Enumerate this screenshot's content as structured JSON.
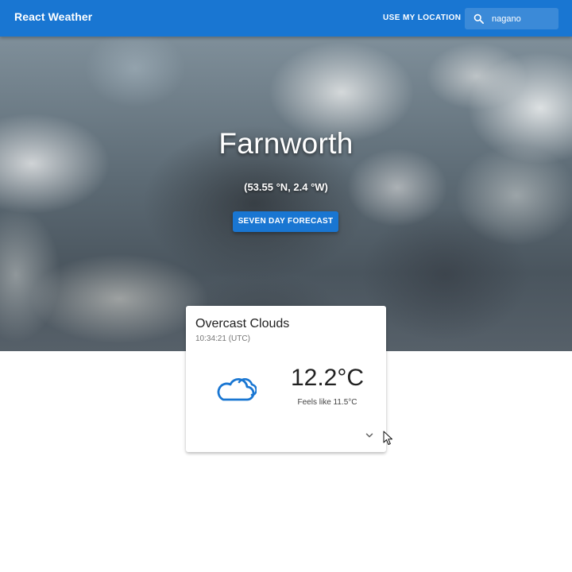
{
  "app": {
    "title": "React Weather"
  },
  "header": {
    "location_button": "Use my location",
    "search": {
      "value": "nagano",
      "icon": "search-icon"
    }
  },
  "hero": {
    "city": "Farnworth",
    "coordinates": "(53.55 °N, 2.4 °W)",
    "forecast_button": "Seven day forecast"
  },
  "current_weather": {
    "condition": "Overcast Clouds",
    "time": "10:34:21 (UTC)",
    "icon": "cloud-icon",
    "temperature": "12.2°C",
    "feels_like": "Feels like 11.5°C",
    "expand_icon": "chevron-down-icon"
  },
  "colors": {
    "primary": "#1976d2",
    "text": "#212121",
    "secondary_text": "#757575"
  }
}
